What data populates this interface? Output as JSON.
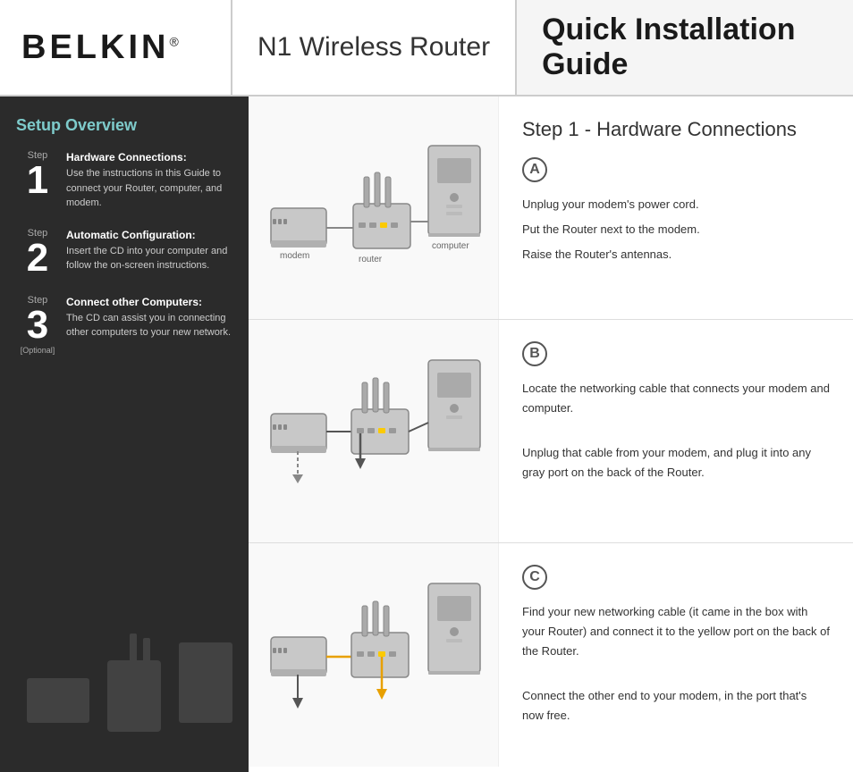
{
  "header": {
    "logo": "BELKIN",
    "logo_tm": "®",
    "product_title": "N1 Wireless Router",
    "guide_title": "Quick Installation Guide"
  },
  "sidebar": {
    "title": "Setup Overview",
    "steps": [
      {
        "step_label": "Step",
        "number": "1",
        "heading": "Hardware Connections:",
        "text": "Use the instructions in this Guide to connect your Router, computer, and modem.",
        "optional": ""
      },
      {
        "step_label": "Step",
        "number": "2",
        "heading": "Automatic Configuration:",
        "text": "Insert the CD into your computer and follow the on-screen instructions.",
        "optional": ""
      },
      {
        "step_label": "Step",
        "number": "3",
        "heading": "Connect other Computers:",
        "text": "The CD can assist you in connecting other computers to your new network.",
        "optional": "[Optional]"
      }
    ]
  },
  "main": {
    "step_title": "Step 1 - Hardware Connections",
    "sections": [
      {
        "badge": "A",
        "lines": [
          "Unplug your modem's power cord.",
          "Put the Router next to the modem.",
          "Raise the Router's antennas."
        ],
        "modem_label": "modem",
        "router_label": "router"
      },
      {
        "badge": "B",
        "lines": [
          "Locate the networking cable that connects your modem and computer.",
          "Unplug that cable from your modem, and plug it into any gray port on the back of the Router."
        ]
      },
      {
        "badge": "C",
        "lines": [
          "Find your new networking cable (it came in the box with your Router) and connect it to the yellow port on the back of the Router.",
          "Connect the other end to your modem, in the port that's now free."
        ]
      }
    ]
  }
}
